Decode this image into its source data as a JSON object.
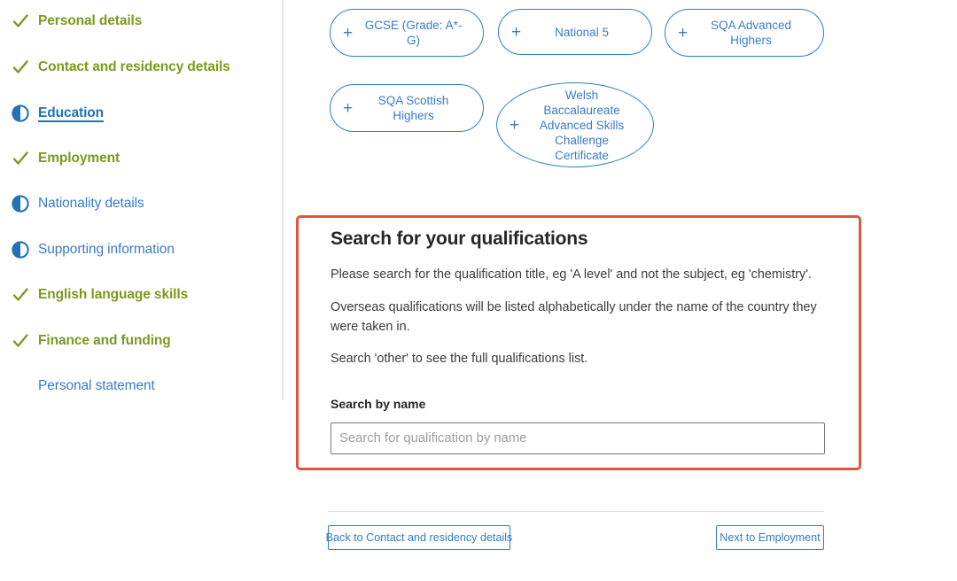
{
  "sidebar": {
    "items": [
      {
        "label": "Personal details",
        "state": "done",
        "icon": "check-icon"
      },
      {
        "label": "Contact and residency details",
        "state": "done",
        "icon": "check-icon"
      },
      {
        "label": "Education",
        "state": "current",
        "icon": "half-circle-icon"
      },
      {
        "label": "Employment",
        "state": "done",
        "icon": "check-icon"
      },
      {
        "label": "Nationality details",
        "state": "partial",
        "icon": "half-circle-icon"
      },
      {
        "label": "Supporting information",
        "state": "partial",
        "icon": "half-circle-icon"
      },
      {
        "label": "English language skills",
        "state": "done",
        "icon": "check-icon"
      },
      {
        "label": "Finance and funding",
        "state": "done",
        "icon": "check-icon"
      },
      {
        "label": "Personal statement",
        "state": "plain",
        "icon": "none"
      }
    ],
    "colors": {
      "done": "#7a9a1f",
      "link": "#3a7cc4",
      "current": "#2172b8"
    }
  },
  "qualifications": {
    "add_icon": "plus-icon",
    "pills": [
      {
        "label": "GCSE (Grade: A*-G)"
      },
      {
        "label": "National 5"
      },
      {
        "label": "SQA Advanced Highers"
      },
      {
        "label": "SQA Scottish Highers"
      },
      {
        "label": "Welsh Baccalaureate Advanced Skills Challenge Certificate"
      }
    ]
  },
  "search_panel": {
    "highlight_color": "#e2553c",
    "heading": "Search for your qualifications",
    "paragraph_1": "Please search for the qualification title, eg 'A level' and not the subject, eg 'chemistry'.",
    "paragraph_2": "Overseas qualifications will be listed alphabetically under the name of the country they were taken in.",
    "paragraph_3": "Search 'other' to see the full qualifications list.",
    "field_label": "Search by name",
    "input_placeholder": "Search for qualification by name",
    "input_value": ""
  },
  "footer": {
    "back_label": "Back to Contact and residency details",
    "next_label": "Next to Employment"
  }
}
